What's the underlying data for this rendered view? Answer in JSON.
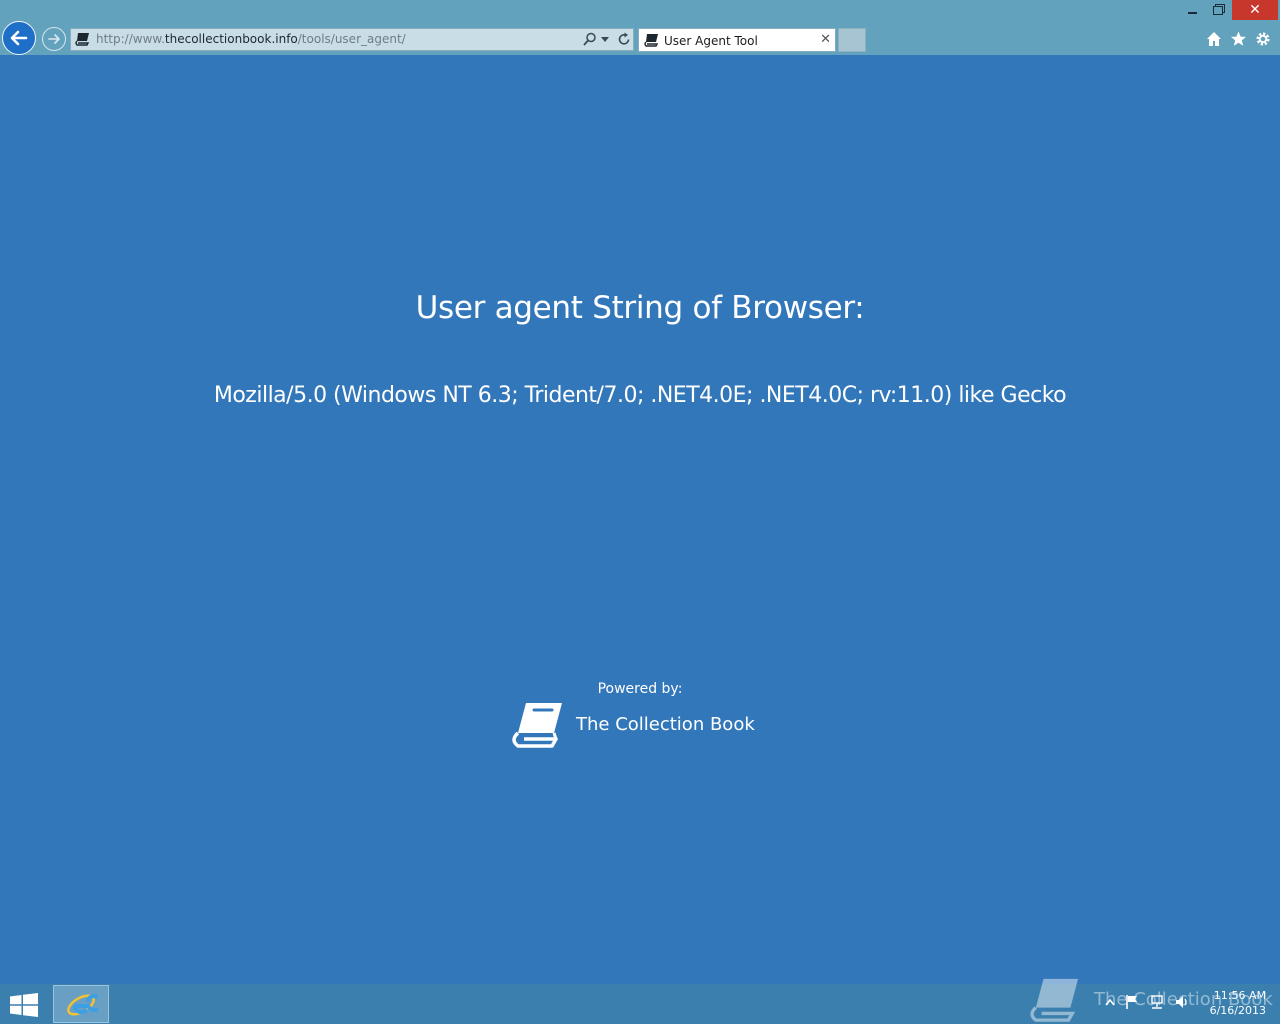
{
  "window": {
    "controls": {
      "minimize_icon": "minimize-icon",
      "restore_icon": "restore-icon",
      "close_label": "✕"
    }
  },
  "browser": {
    "address": {
      "url_prefix": "http://www.",
      "url_domain": "thecollectionbook.info",
      "url_path": "/tools/user_agent/"
    },
    "tab": {
      "title": "User Agent Tool",
      "close_label": "✕"
    },
    "icons": [
      "back-icon",
      "forward-icon",
      "search-icon",
      "dropdown-icon",
      "refresh-icon",
      "home-icon",
      "star-icon",
      "gear-icon"
    ]
  },
  "page": {
    "heading": "User agent String of Browser:",
    "user_agent": "Mozilla/5.0 (Windows NT 6.3; Trident/7.0; .NET4.0E; .NET4.0C; rv:11.0) like Gecko",
    "powered_by": "Powered by:",
    "brand": "The Collection Book"
  },
  "taskbar": {
    "watermark": "The Collection Book",
    "clock": {
      "time": "11:56 AM",
      "date": "6/16/2013"
    }
  },
  "colors": {
    "page_bg": "#3377bb",
    "chrome_bg": "#63a2bd",
    "taskbar_bg": "#3a7fae",
    "close_button": "#c7372c"
  }
}
